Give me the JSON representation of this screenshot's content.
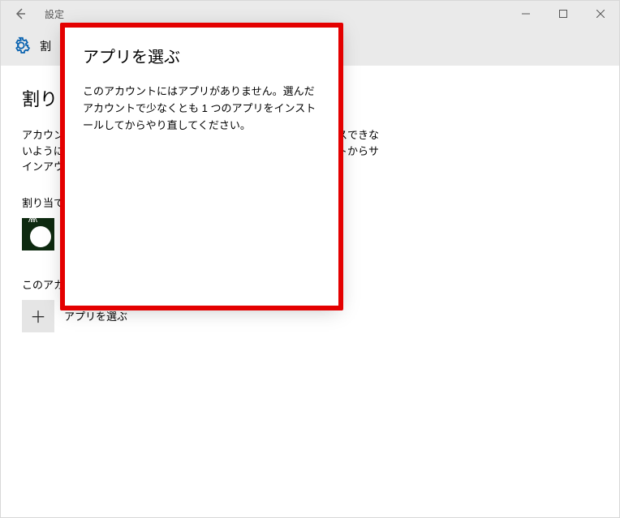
{
  "titlebar": {
    "title": "設定"
  },
  "header": {
    "label": "割"
  },
  "page": {
    "title": "割り",
    "desc1": "アカウン",
    "desc2": "いように",
    "desc3": "インアウ",
    "desc_tail1": "スできな",
    "desc_tail2": "ントからサ",
    "subhead": "割り当て",
    "accountLine": "このアカ"
  },
  "action": {
    "label": "アプリを選ぶ"
  },
  "flyout": {
    "title": "アプリを選ぶ",
    "body": "このアカウントにはアプリがありません。選んだアカウントで少なくとも 1 つのアプリをインストールしてからやり直してください。"
  }
}
